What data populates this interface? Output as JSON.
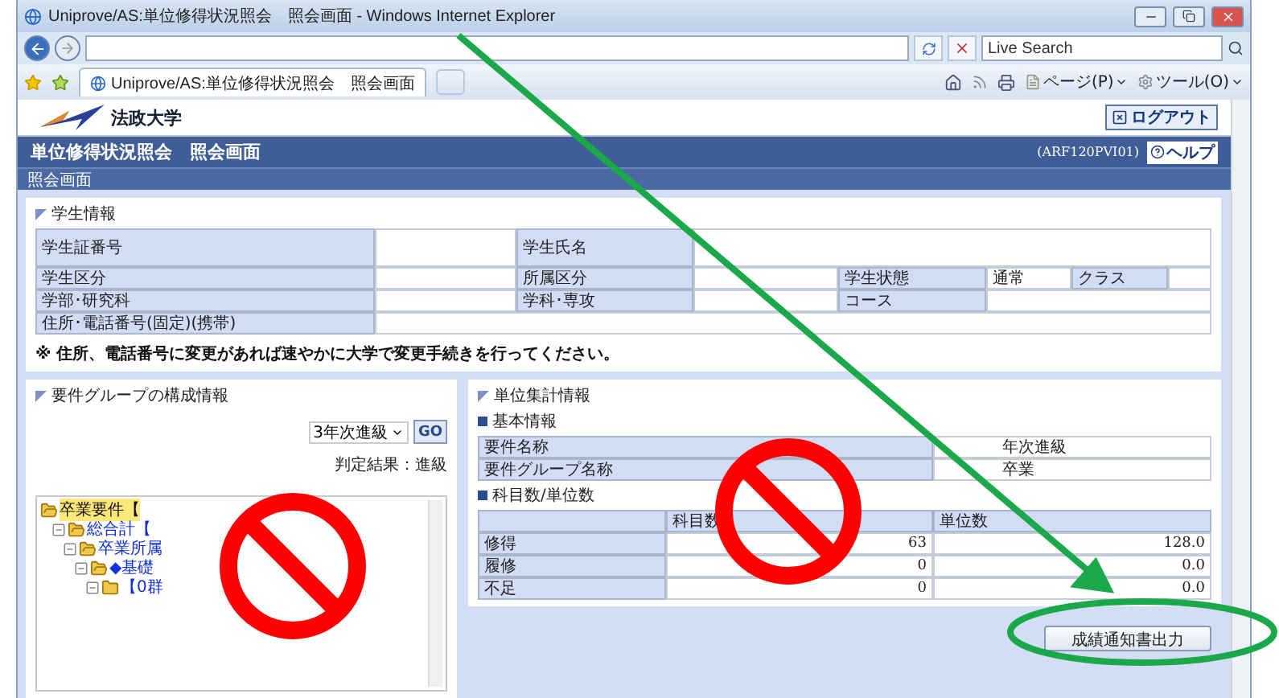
{
  "window": {
    "title": "Uniprove/AS:単位修得状況照会　照会画面 - Windows Internet Explorer"
  },
  "search": {
    "placeholder": "Live Search"
  },
  "tab": {
    "title": "Uniprove/AS:単位修得状況照会　照会画面"
  },
  "toolbar": {
    "items": [
      "ページ(P)",
      "ツール(O)"
    ]
  },
  "header": {
    "logo": "法政大学",
    "logout": "ログアウト",
    "page_title": "単位修得状況照会　照会画面",
    "screen_id": "(ARF120PVI01)",
    "help": "ヘルプ",
    "breadcrumb": "照会画面"
  },
  "student_info": {
    "title": "学生情報",
    "rows": [
      [
        {
          "label": "学生証番号"
        },
        {
          "label": "学生氏名"
        }
      ],
      [
        {
          "label": "学生区分"
        },
        {
          "label": "所属区分"
        },
        {
          "label": "学生状態",
          "value": "通常"
        },
        {
          "label": "クラス"
        }
      ],
      [
        {
          "label": "学部･研究科"
        },
        {
          "label": "学科･専攻"
        },
        {
          "label": "コース"
        }
      ],
      [
        {
          "label": "住所･電話番号(固定)(携帯)"
        }
      ]
    ],
    "note": "※ 住所、電話番号に変更があれば速やかに大学で変更手続きを行ってください。"
  },
  "requirement_panel": {
    "title": "要件グループの構成情報",
    "select": "3年次進級",
    "go": "GO",
    "result": "判定結果：進級",
    "tree": [
      {
        "label": "卒業要件【",
        "selected": true,
        "children": [
          {
            "label": "総合計【",
            "selected": false,
            "expanded": true,
            "children": [
              {
                "label": "卒業所属",
                "selected": false,
                "expanded": true,
                "children": [
                  {
                    "label": "◆基礎",
                    "selected": false,
                    "expanded": true,
                    "children": [
                      {
                        "label": "【0群",
                        "selected": false,
                        "expanded": true
                      }
                    ]
                  }
                ]
              }
            ]
          }
        ]
      }
    ]
  },
  "credit_panel": {
    "title": "単位集計情報",
    "basic_title": "基本情報",
    "basic": [
      {
        "label": "要件名称",
        "value": "年次進級"
      },
      {
        "label": "要件グループ名称",
        "value": "卒業"
      }
    ],
    "counts_title": "科目数/単位数",
    "columns": [
      "科目数",
      "単位数"
    ],
    "rows": [
      {
        "label": "修得",
        "subjects": "63",
        "credits": "128.0"
      },
      {
        "label": "履修",
        "subjects": "0",
        "credits": "0.0"
      },
      {
        "label": "不足",
        "subjects": "0",
        "credits": "0.0"
      }
    ],
    "button": "成績通知書出力"
  }
}
